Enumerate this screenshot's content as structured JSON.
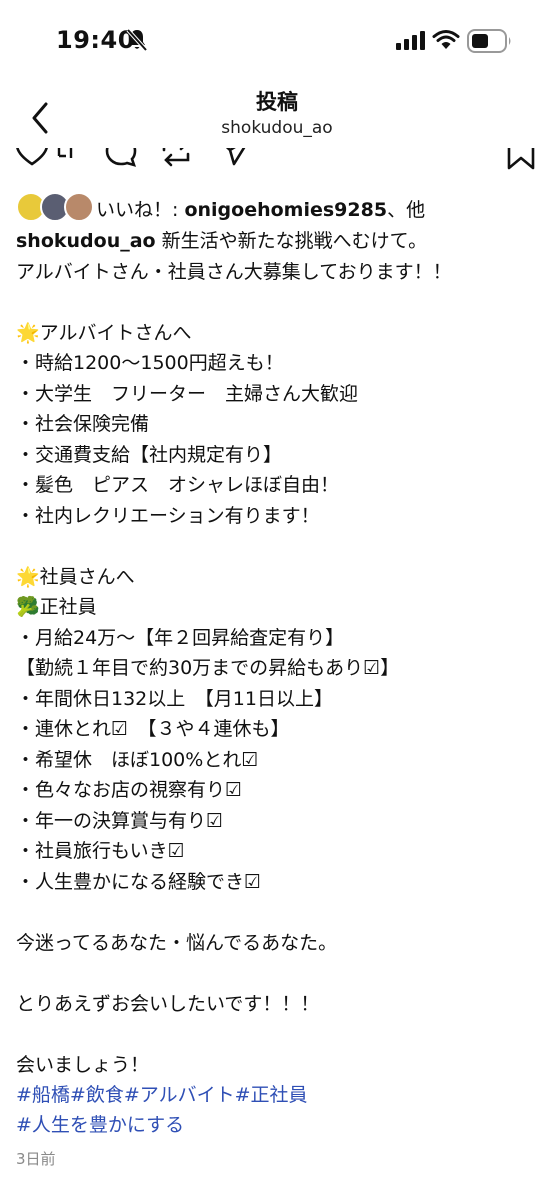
{
  "status": {
    "time": "19:40"
  },
  "nav": {
    "title": "投稿",
    "subtitle": "shokudou_ao"
  },
  "likes": {
    "prefix": "いいね！: ",
    "user": "onigoehomies9285",
    "suffix": "、他"
  },
  "post": {
    "username": "shokudou_ao",
    "caption_first": " 新生活や新たな挑戦へむけて。",
    "caption_lines": [
      "アルバイトさん・社員さん大募集しております！！",
      "",
      "🌟アルバイトさんへ",
      "・時給1200～1500円超えも！",
      "・大学生　フリーター　主婦さん大歓迎",
      "・社会保険完備",
      "・交通費支給【社内規定有り】",
      "・髪色　ピアス　オシャレほぼ自由！",
      "・社内レクリエーション有ります！",
      "",
      "🌟社員さんへ",
      "🥦正社員",
      "・月給24万～【年２回昇給査定有り】",
      "【勤続１年目で約30万までの昇給もあり☑】",
      "・年間休日132以上　【月11日以上】",
      "・連休とれ☑　【３や４連休も】",
      "・希望休　ほぼ100%とれ☑",
      "・色々なお店の視察有り☑",
      "・年一の決算賞与有り☑",
      "・社員旅行もいき☑",
      "・人生豊かになる経験でき☑",
      "",
      "今迷ってるあなた・悩んでるあなた。",
      "",
      "とりあえずお会いしたいです！！！",
      "",
      "会いましょう！"
    ],
    "hashtags": [
      "#船橋#飲食#アルバイト#正社員",
      "#人生を豊かにする"
    ],
    "date": "3日前"
  },
  "colors": {
    "hashtag": "#2f4fb5",
    "date": "#8a8a8a"
  },
  "icons": {
    "status": [
      "bell-slash-icon",
      "signal-icon",
      "wifi-icon",
      "battery-icon"
    ],
    "nav": "chevron-left-icon",
    "actions": [
      "heart-icon",
      "comment-icon",
      "repost-icon",
      "share-icon",
      "bookmark-icon"
    ]
  }
}
